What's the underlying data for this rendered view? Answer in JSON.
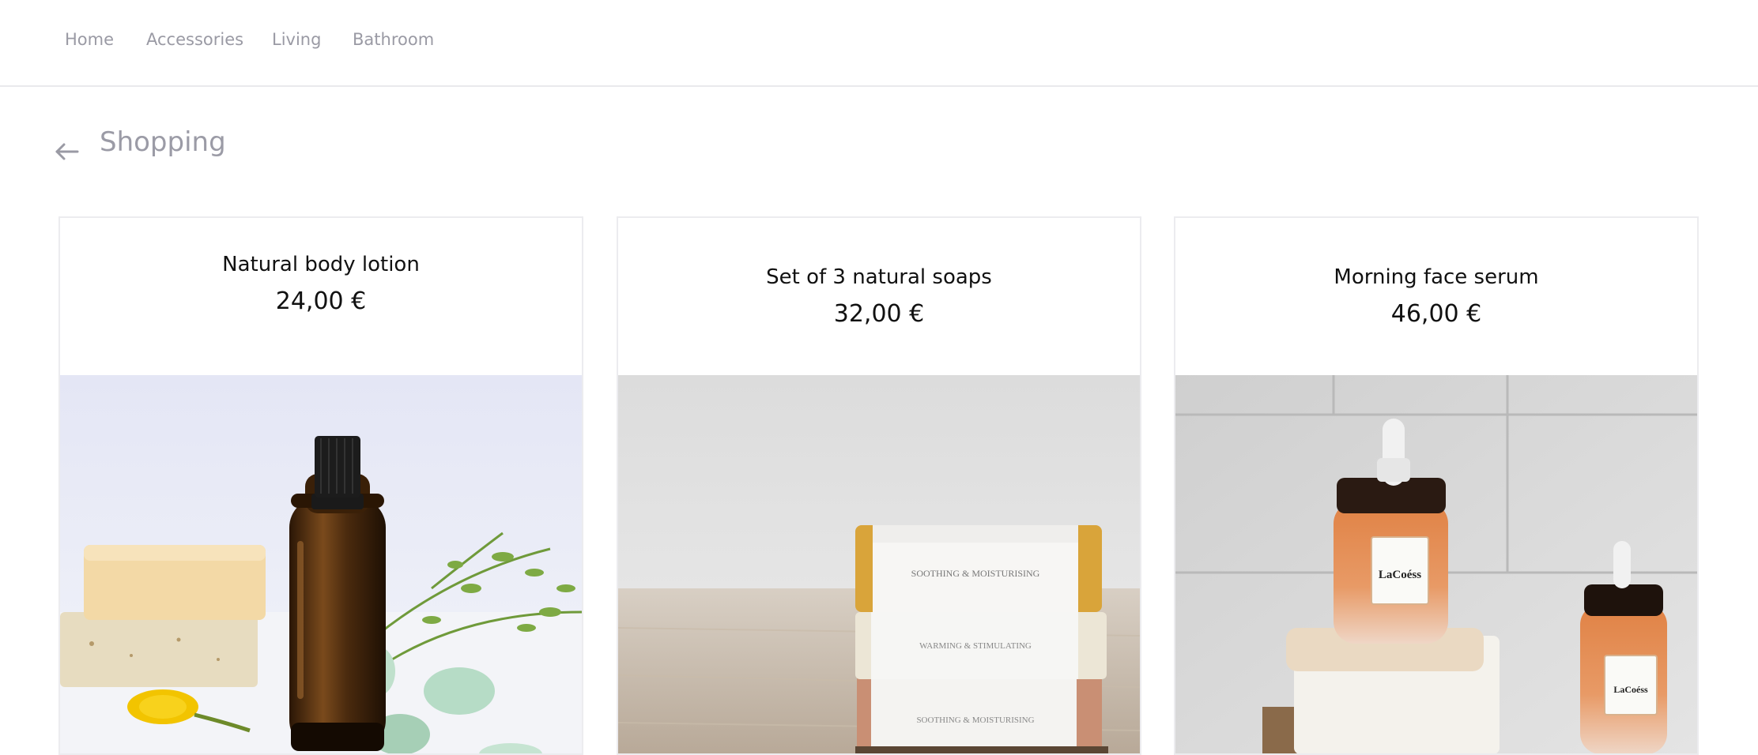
{
  "nav": {
    "items": [
      {
        "label": "Home"
      },
      {
        "label": "Accessories"
      },
      {
        "label": "Living"
      },
      {
        "label": "Bathroom"
      }
    ]
  },
  "page": {
    "title": "Shopping"
  },
  "products": [
    {
      "name": "Natural body lotion",
      "price": "24,00 €"
    },
    {
      "name": "Set of 3 natural soaps",
      "price": "32,00 €",
      "box_labels": [
        "SOOTHING & MOISTURISING",
        "WARMING & STIMULATING",
        "SOOTHING & MOISTURISING"
      ]
    },
    {
      "name": "Morning face serum",
      "price": "46,00 €",
      "brand": "LaCoéss"
    }
  ],
  "icons": {
    "back": "arrow-left-icon"
  },
  "colors": {
    "nav_text": "#9a9aa4",
    "title_text": "#9b9ba6",
    "card_border": "#ececef",
    "amber_bottle": "#4a2a0e",
    "serum_orange": "#e2915a"
  }
}
